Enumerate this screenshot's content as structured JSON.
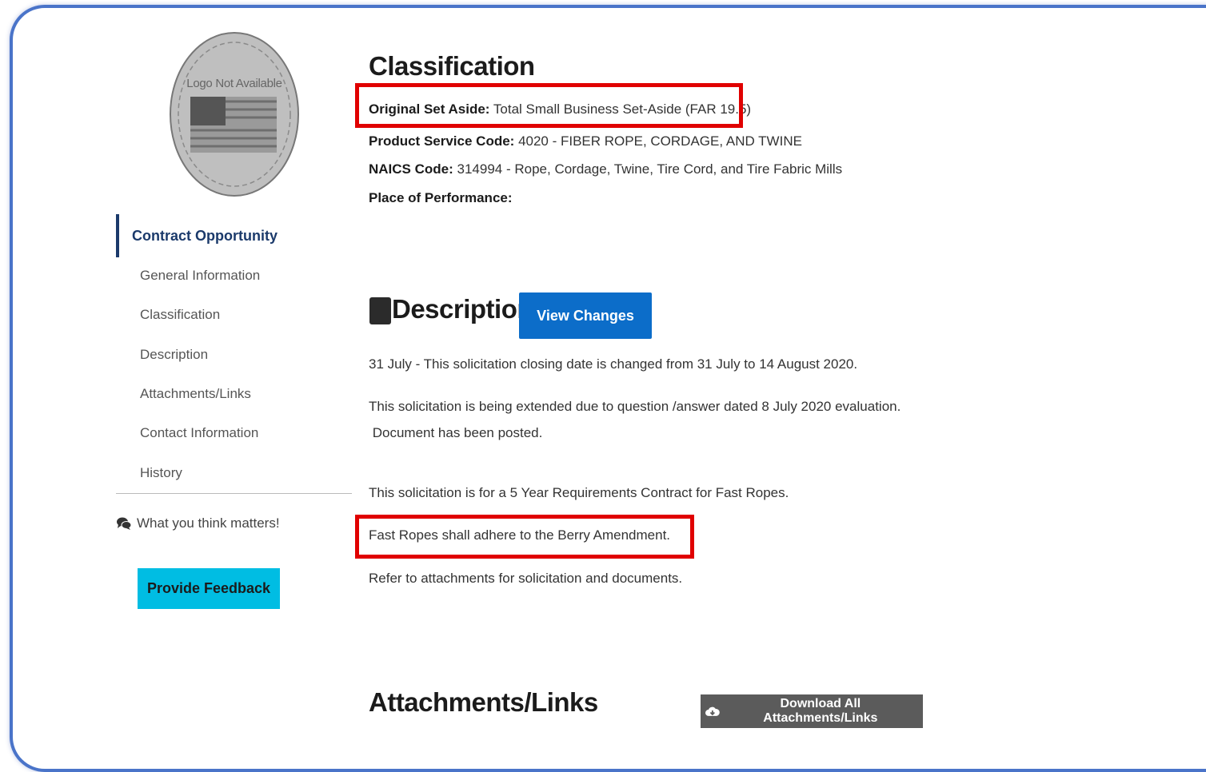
{
  "logo": {
    "text": "Logo Not Available"
  },
  "sidebar": {
    "active": "Contract Opportunity",
    "items": [
      {
        "label": "General Information"
      },
      {
        "label": "Classification"
      },
      {
        "label": "Description"
      },
      {
        "label": "Attachments/Links"
      },
      {
        "label": "Contact Information"
      },
      {
        "label": "History"
      }
    ],
    "feedback_note": "What you think matters!",
    "feedback_button": "Provide Feedback"
  },
  "classification": {
    "heading": "Classification",
    "set_aside_label": "Original Set Aside:",
    "set_aside_value": "Total Small Business Set-Aside (FAR 19.5)",
    "psc_label": "Product Service Code:",
    "psc_value": "4020 - FIBER ROPE, CORDAGE, AND TWINE",
    "naics_label": "NAICS Code:",
    "naics_value": "314994 - Rope, Cordage, Twine, Tire Cord, and Tire Fabric Mills",
    "place_label": "Place of Performance:"
  },
  "description": {
    "heading": "Description",
    "view_changes_button": "View Changes",
    "paragraphs": [
      "31 July - This solicitation closing date is changed from 31 July to  14 August 2020.",
      "This solicitation is being extended due to question /answer dated 8 July 2020 evaluation.",
      " Document has been posted.",
      "This solicitation is for a 5 Year Requirements Contract for Fast Ropes.",
      "Fast Ropes shall adhere to the Berry Amendment.",
      "Refer to attachments for solicitation and documents."
    ]
  },
  "attachments": {
    "heading": "Attachments/Links",
    "download_button": "Download All Attachments/Links"
  },
  "colors": {
    "highlight_box": "#e00000",
    "primary_button": "#0c6dc9",
    "feedback_button": "#00bde3",
    "download_button": "#5b5b5b",
    "sidebar_active": "#1b3a6b"
  }
}
